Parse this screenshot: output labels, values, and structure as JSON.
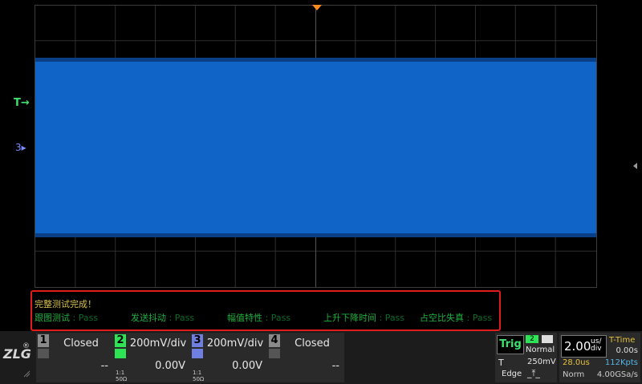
{
  "markers": {
    "trigger_level": "T",
    "channel3": "3"
  },
  "results": {
    "title": "完整测试完成！",
    "items": [
      {
        "name": "跟图测试",
        "status": "Pass"
      },
      {
        "name": "发送抖动",
        "status": "Pass"
      },
      {
        "name": "幅值特性",
        "status": "Pass"
      },
      {
        "name": "上升下降时间",
        "status": "Pass"
      },
      {
        "name": "占空比失真",
        "status": "Pass"
      }
    ]
  },
  "logo": "ZLG",
  "registered": "®",
  "channels": [
    {
      "number": "1",
      "label": "Closed",
      "offset": "--",
      "coupling": "",
      "impedance": ""
    },
    {
      "number": "2",
      "label": "200mV/div",
      "offset": "0.00V",
      "coupling": "1:1",
      "impedance": "50Ω"
    },
    {
      "number": "3",
      "label": "200mV/div",
      "offset": "0.00V",
      "coupling": "1:1",
      "impedance": "50Ω"
    },
    {
      "number": "4",
      "label": "Closed",
      "offset": "--",
      "coupling": "",
      "impedance": ""
    }
  ],
  "trigger": {
    "button": "Trig",
    "source": "2",
    "mode": "Normal",
    "t_label": "T",
    "level": "250mV",
    "type": "Edge",
    "edge": "_⤒_"
  },
  "timebase": {
    "div_value": "2.00",
    "div_unit_top": "us/",
    "div_unit_bottom": "div",
    "mode": "T-Time",
    "time": "0.00s",
    "delay": "28.0us",
    "memory": "112Kpts",
    "acq_mode": "Norm",
    "sample_rate": "4.00GSa/s"
  },
  "colors": {
    "waveform": "#1064c8",
    "ch2": "#2ee354",
    "ch3": "#6f7fe0",
    "trigger_marker": "#ff8a1e",
    "result_border": "#e21b1b",
    "pass_text": "#1eb03e"
  }
}
